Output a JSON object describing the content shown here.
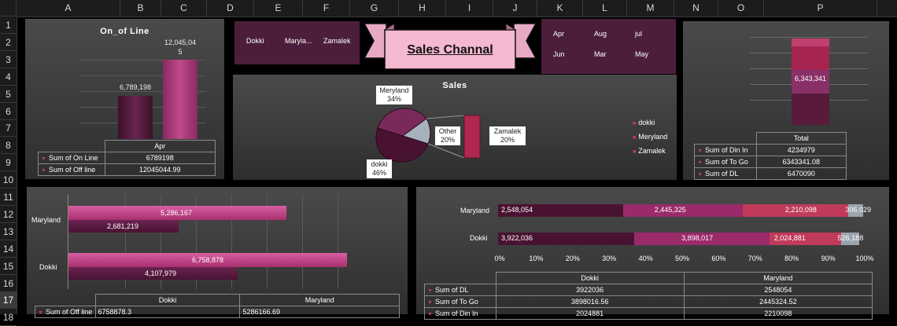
{
  "columns": [
    "A",
    "B",
    "C",
    "D",
    "E",
    "F",
    "G",
    "H",
    "I",
    "J",
    "K",
    "L",
    "M",
    "N",
    "O",
    "P"
  ],
  "rows": [
    "1",
    "2",
    "3",
    "4",
    "5",
    "6",
    "7",
    "8",
    "9",
    "10",
    "11",
    "12",
    "13",
    "14",
    "15",
    "16",
    "17",
    "18"
  ],
  "selected_row": "17",
  "banner_title": "Sales Channal",
  "slicer_branches": [
    "Dokki",
    "Maryla...",
    "Zamalek"
  ],
  "slicer_months": [
    "Apr",
    "Aug",
    "jul",
    "Jun",
    "Mar",
    "May"
  ],
  "online_chart": {
    "title": "On_of Line",
    "bar1_label": "6,789,198",
    "bar2_label_line1": "12,045,04",
    "bar2_label_line2": "5",
    "table_header": "Apr",
    "rows": [
      {
        "label": "Sum of On Line",
        "value": "6789198"
      },
      {
        "label": "Sum of Off line",
        "value": "12045044.99"
      }
    ]
  },
  "pie_chart": {
    "title": "Sales",
    "labels": [
      {
        "name": "Meryland",
        "pct": "34%"
      },
      {
        "name": "Other",
        "pct": "20%"
      },
      {
        "name": "Zamalek",
        "pct": "20%"
      },
      {
        "name": "dokki",
        "pct": "46%"
      }
    ],
    "legend": [
      "dokki",
      "Meryland",
      "Zamalek"
    ]
  },
  "delivery_chart": {
    "value_label": "6,343,341",
    "table_header": "Total",
    "rows": [
      {
        "label": "Sum of Din In",
        "value": "4234979"
      },
      {
        "label": "Sum of To Go",
        "value": "6343341.08"
      },
      {
        "label": "Sum of DL",
        "value": "6470090"
      }
    ]
  },
  "bar_chart": {
    "categories": [
      "Maryland",
      "Dokki"
    ],
    "bars": [
      {
        "label": "5,286,167"
      },
      {
        "label": "2,681,219"
      },
      {
        "label": "6,758,878"
      },
      {
        "label": "4,107,979"
      }
    ],
    "table_headers": [
      "Dokki",
      "Maryland"
    ],
    "table_row": {
      "label": "Sum of Off line",
      "v1": "6758878.3",
      "v2": "5286166.69"
    }
  },
  "stacked_chart": {
    "categories": [
      "Maryland",
      "Dokki"
    ],
    "maryland_labels": [
      "2,548,054",
      "2,445,325",
      "2,210,098",
      "306,029"
    ],
    "dokki_labels": [
      "3,922,036",
      "3,898,017",
      "2,024,881",
      "526,188"
    ],
    "axis_ticks": [
      "0%",
      "10%",
      "20%",
      "30%",
      "40%",
      "50%",
      "60%",
      "70%",
      "80%",
      "90%",
      "100%"
    ],
    "table_headers": [
      "Dokki",
      "Maryland"
    ],
    "rows": [
      {
        "label": "Sum of DL",
        "v1": "3922036",
        "v2": "2548054"
      },
      {
        "label": "Sum of To Go",
        "v1": "3898016.56",
        "v2": "2445324.52"
      },
      {
        "label": "Sum of Din In",
        "v1": "2024881",
        "v2": "2210098"
      }
    ]
  },
  "chart_data": [
    {
      "type": "bar",
      "title": "On_of Line",
      "categories": [
        "Apr"
      ],
      "series": [
        {
          "name": "Sum of On Line",
          "values": [
            6789198
          ]
        },
        {
          "name": "Sum of Off line",
          "values": [
            12045044.99
          ]
        }
      ]
    },
    {
      "type": "pie",
      "title": "Sales",
      "categories": [
        "dokki",
        "Meryland",
        "Other",
        "Zamalek"
      ],
      "values": [
        46,
        34,
        20,
        20
      ]
    },
    {
      "type": "bar",
      "categories": [
        "Total"
      ],
      "series": [
        {
          "name": "Sum of Din In",
          "values": [
            4234979
          ]
        },
        {
          "name": "Sum of To Go",
          "values": [
            6343341.08
          ]
        },
        {
          "name": "Sum of DL",
          "values": [
            6470090
          ]
        }
      ]
    },
    {
      "type": "bar",
      "categories": [
        "Maryland",
        "Dokki"
      ],
      "series": [
        {
          "name": "Sum of Off line",
          "values": [
            5286166.69,
            6758878.3
          ]
        },
        {
          "values": [
            2681219,
            4107979
          ]
        }
      ]
    },
    {
      "type": "bar",
      "stacked": "percent",
      "categories": [
        "Maryland",
        "Dokki"
      ],
      "series": [
        {
          "name": "Sum of DL",
          "values": [
            2548054,
            3922036
          ]
        },
        {
          "name": "Sum of To Go",
          "values": [
            2445324.52,
            3898016.56
          ]
        },
        {
          "name": "Sum of Din In",
          "values": [
            2210098,
            2024881
          ]
        },
        {
          "values": [
            306029,
            526188
          ]
        }
      ],
      "xlim": [
        0,
        100
      ]
    }
  ]
}
